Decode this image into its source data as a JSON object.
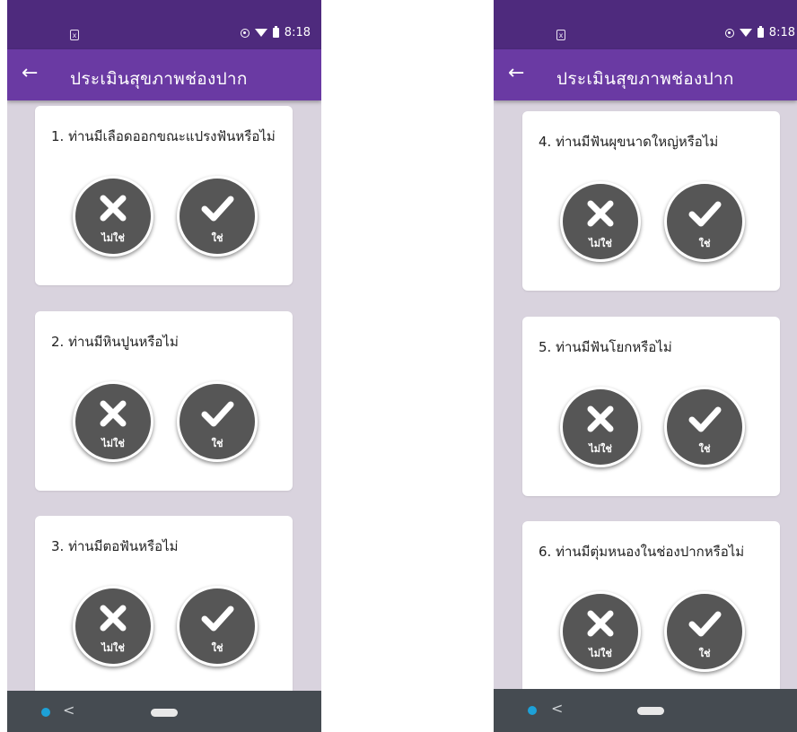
{
  "status_bar": {
    "time": "8:18"
  },
  "app_bar": {
    "title": "ประเมินสุขภาพช่องปาก"
  },
  "buttons": {
    "no_label": "ไม่ใช่",
    "yes_label": "ใช่"
  },
  "left_screen": {
    "questions": [
      "1. ท่านมีเลือดออกขณะแปรงฟันหรือไม่",
      "2. ท่านมีหินปูนหรือไม่",
      "3. ท่านมีตอฟันหรือไม่"
    ]
  },
  "right_screen": {
    "questions": [
      "4. ท่านมีฟันผุขนาดใหญ่หรือไม่",
      "5. ท่านมีฟันโยกหรือไม่",
      "6. ท่านมีตุ่มหนองในช่องปากหรือไม่"
    ]
  },
  "colors": {
    "status_bar": "#4e2a7d",
    "app_bar": "#6a3aa3",
    "background": "#d9d3de",
    "button": "#565656",
    "nav_bar": "#454b51",
    "nav_dot": "#1da1d8"
  },
  "icons": {
    "back": "arrow-left-icon",
    "no": "x-icon",
    "yes": "check-icon"
  }
}
